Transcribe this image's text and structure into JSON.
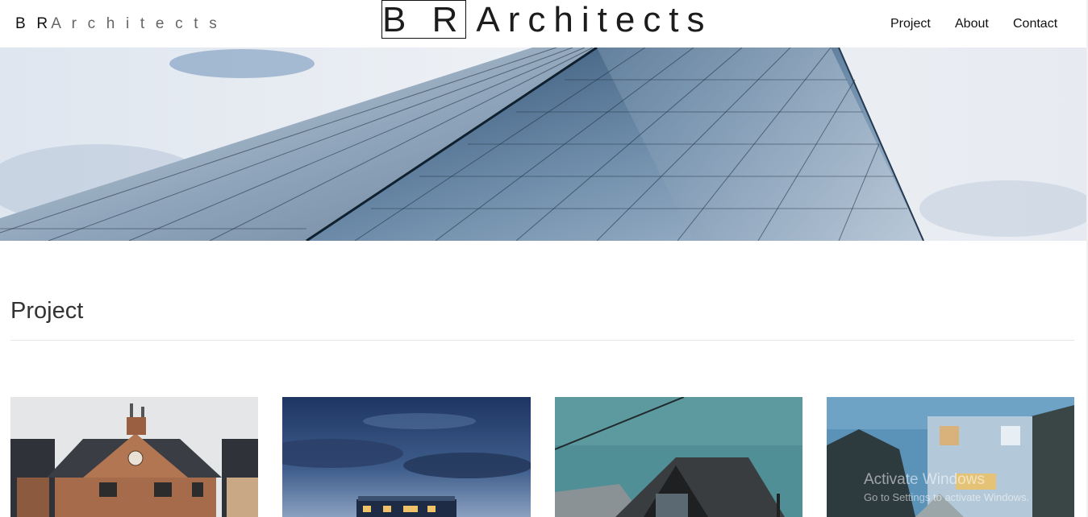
{
  "header": {
    "logo_small_initials": "B R",
    "logo_small_rest": "A r c h i t e c t s",
    "logo_big_initials": "B R",
    "logo_big_rest": "Architects",
    "nav": [
      {
        "label": "Project"
      },
      {
        "label": "About"
      },
      {
        "label": "Contact"
      }
    ]
  },
  "hero": {
    "image": "glass-building-facade"
  },
  "projects": {
    "title": "Project",
    "cards": [
      {
        "image": "brick-houses"
      },
      {
        "image": "building-at-dusk"
      },
      {
        "image": "gabled-black-house"
      },
      {
        "image": "modern-house-evening"
      }
    ]
  },
  "watermark": {
    "title": "Activate Windows",
    "subtitle": "Go to Settings to activate Windows."
  },
  "colors": {
    "text": "#222222",
    "divider": "#e6e6e6",
    "sky": "#e9edf3",
    "glass": "#4f6f8f"
  }
}
